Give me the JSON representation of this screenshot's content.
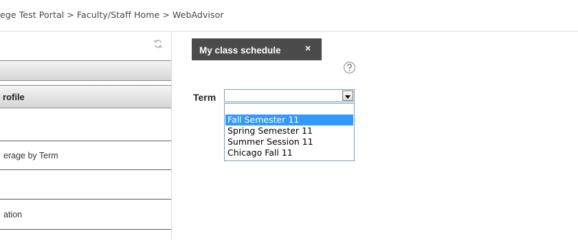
{
  "breadcrumb": {
    "items": [
      "ege Test Portal",
      "Faculty/Staff Home",
      "WebAdvisor"
    ],
    "separator": ">"
  },
  "left_panel": {
    "bar_1_label": "",
    "bar_2_label": "rofile",
    "links": [
      "",
      "erage by Term",
      "",
      "ation"
    ]
  },
  "tab": {
    "label": "My class schedule",
    "close": "×"
  },
  "form": {
    "term_label": "Term",
    "term_value": "",
    "term_options": [
      "",
      "Fall Semester 11",
      "Spring Semester 11",
      "Summer Session 11",
      "Chicago Fall 11"
    ],
    "highlighted_option": "Fall Semester 11"
  },
  "icons": {
    "refresh": "refresh-icon",
    "help": "help-icon",
    "close": "close-icon",
    "dropdown_arrow": "chevron-down-icon"
  },
  "colors": {
    "tab_bg": "#4b4b4b",
    "option_highlight": "#3399ff",
    "select_border": "#7f9db9"
  }
}
